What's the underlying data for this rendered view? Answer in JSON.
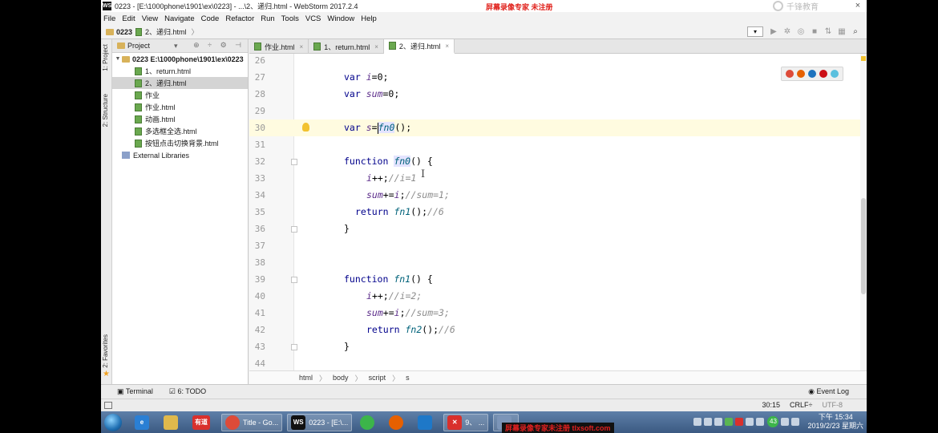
{
  "window": {
    "title": "0223 - [E:\\1000phone\\1901\\ex\\0223] - ...\\2、递归.html - WebStorm 2017.2.4",
    "recorder_watermark": "屏幕录像专家  未注册",
    "logo_text": "千锋教育",
    "close_glyph": "×"
  },
  "menu": [
    "File",
    "Edit",
    "View",
    "Navigate",
    "Code",
    "Refactor",
    "Run",
    "Tools",
    "VCS",
    "Window",
    "Help"
  ],
  "navbar": {
    "project": "0223",
    "file": "2、递归.html",
    "sep": "〉"
  },
  "toolstrip": {
    "project_tab": "1: Project",
    "structure_tab": "2: Structure",
    "favorites_tab": "2: Favorites"
  },
  "project_panel": {
    "title": "Project",
    "root": "0223  E:\\1000phone\\1901\\ex\\0223",
    "items": [
      "1、return.html",
      "2、递归.html",
      "作业",
      "作业.html",
      "动画.html",
      "多选框全选.html",
      "按钮点击切换背景.html"
    ],
    "external": "External Libraries"
  },
  "tabs": [
    {
      "label": "作业.html"
    },
    {
      "label": "1、return.html"
    },
    {
      "label": "2、递归.html"
    }
  ],
  "editor": {
    "lines": [
      "26",
      "27",
      "28",
      "29",
      "30",
      "31",
      "32",
      "33",
      "34",
      "35",
      "36",
      "37",
      "38",
      "39",
      "40",
      "41",
      "42",
      "43",
      "44"
    ]
  },
  "code_crumbs": [
    "html",
    "body",
    "script",
    "s"
  ],
  "bottom_tools": {
    "terminal": "Terminal",
    "todo": "6: TODO",
    "event_log": "Event Log"
  },
  "status": {
    "position": "30:15",
    "line_sep": "CRLF÷",
    "encoding": "UTF-8"
  },
  "taskbar": {
    "youdao": "有道",
    "chrome": "Title - Go...",
    "webstorm": "0223 - [E:\\...",
    "word_task": "9、 ...",
    "explorer_task": "",
    "tray_badge": "43",
    "time": "下午 15:34",
    "date": "2019/2/23 星期六",
    "tx_watermark": "屏幕录像专家未注册 tlxsoft.com"
  },
  "colors": {
    "accent_red": "#e0201a",
    "current_line": "#fffbe0",
    "keyword": "#00008b"
  }
}
